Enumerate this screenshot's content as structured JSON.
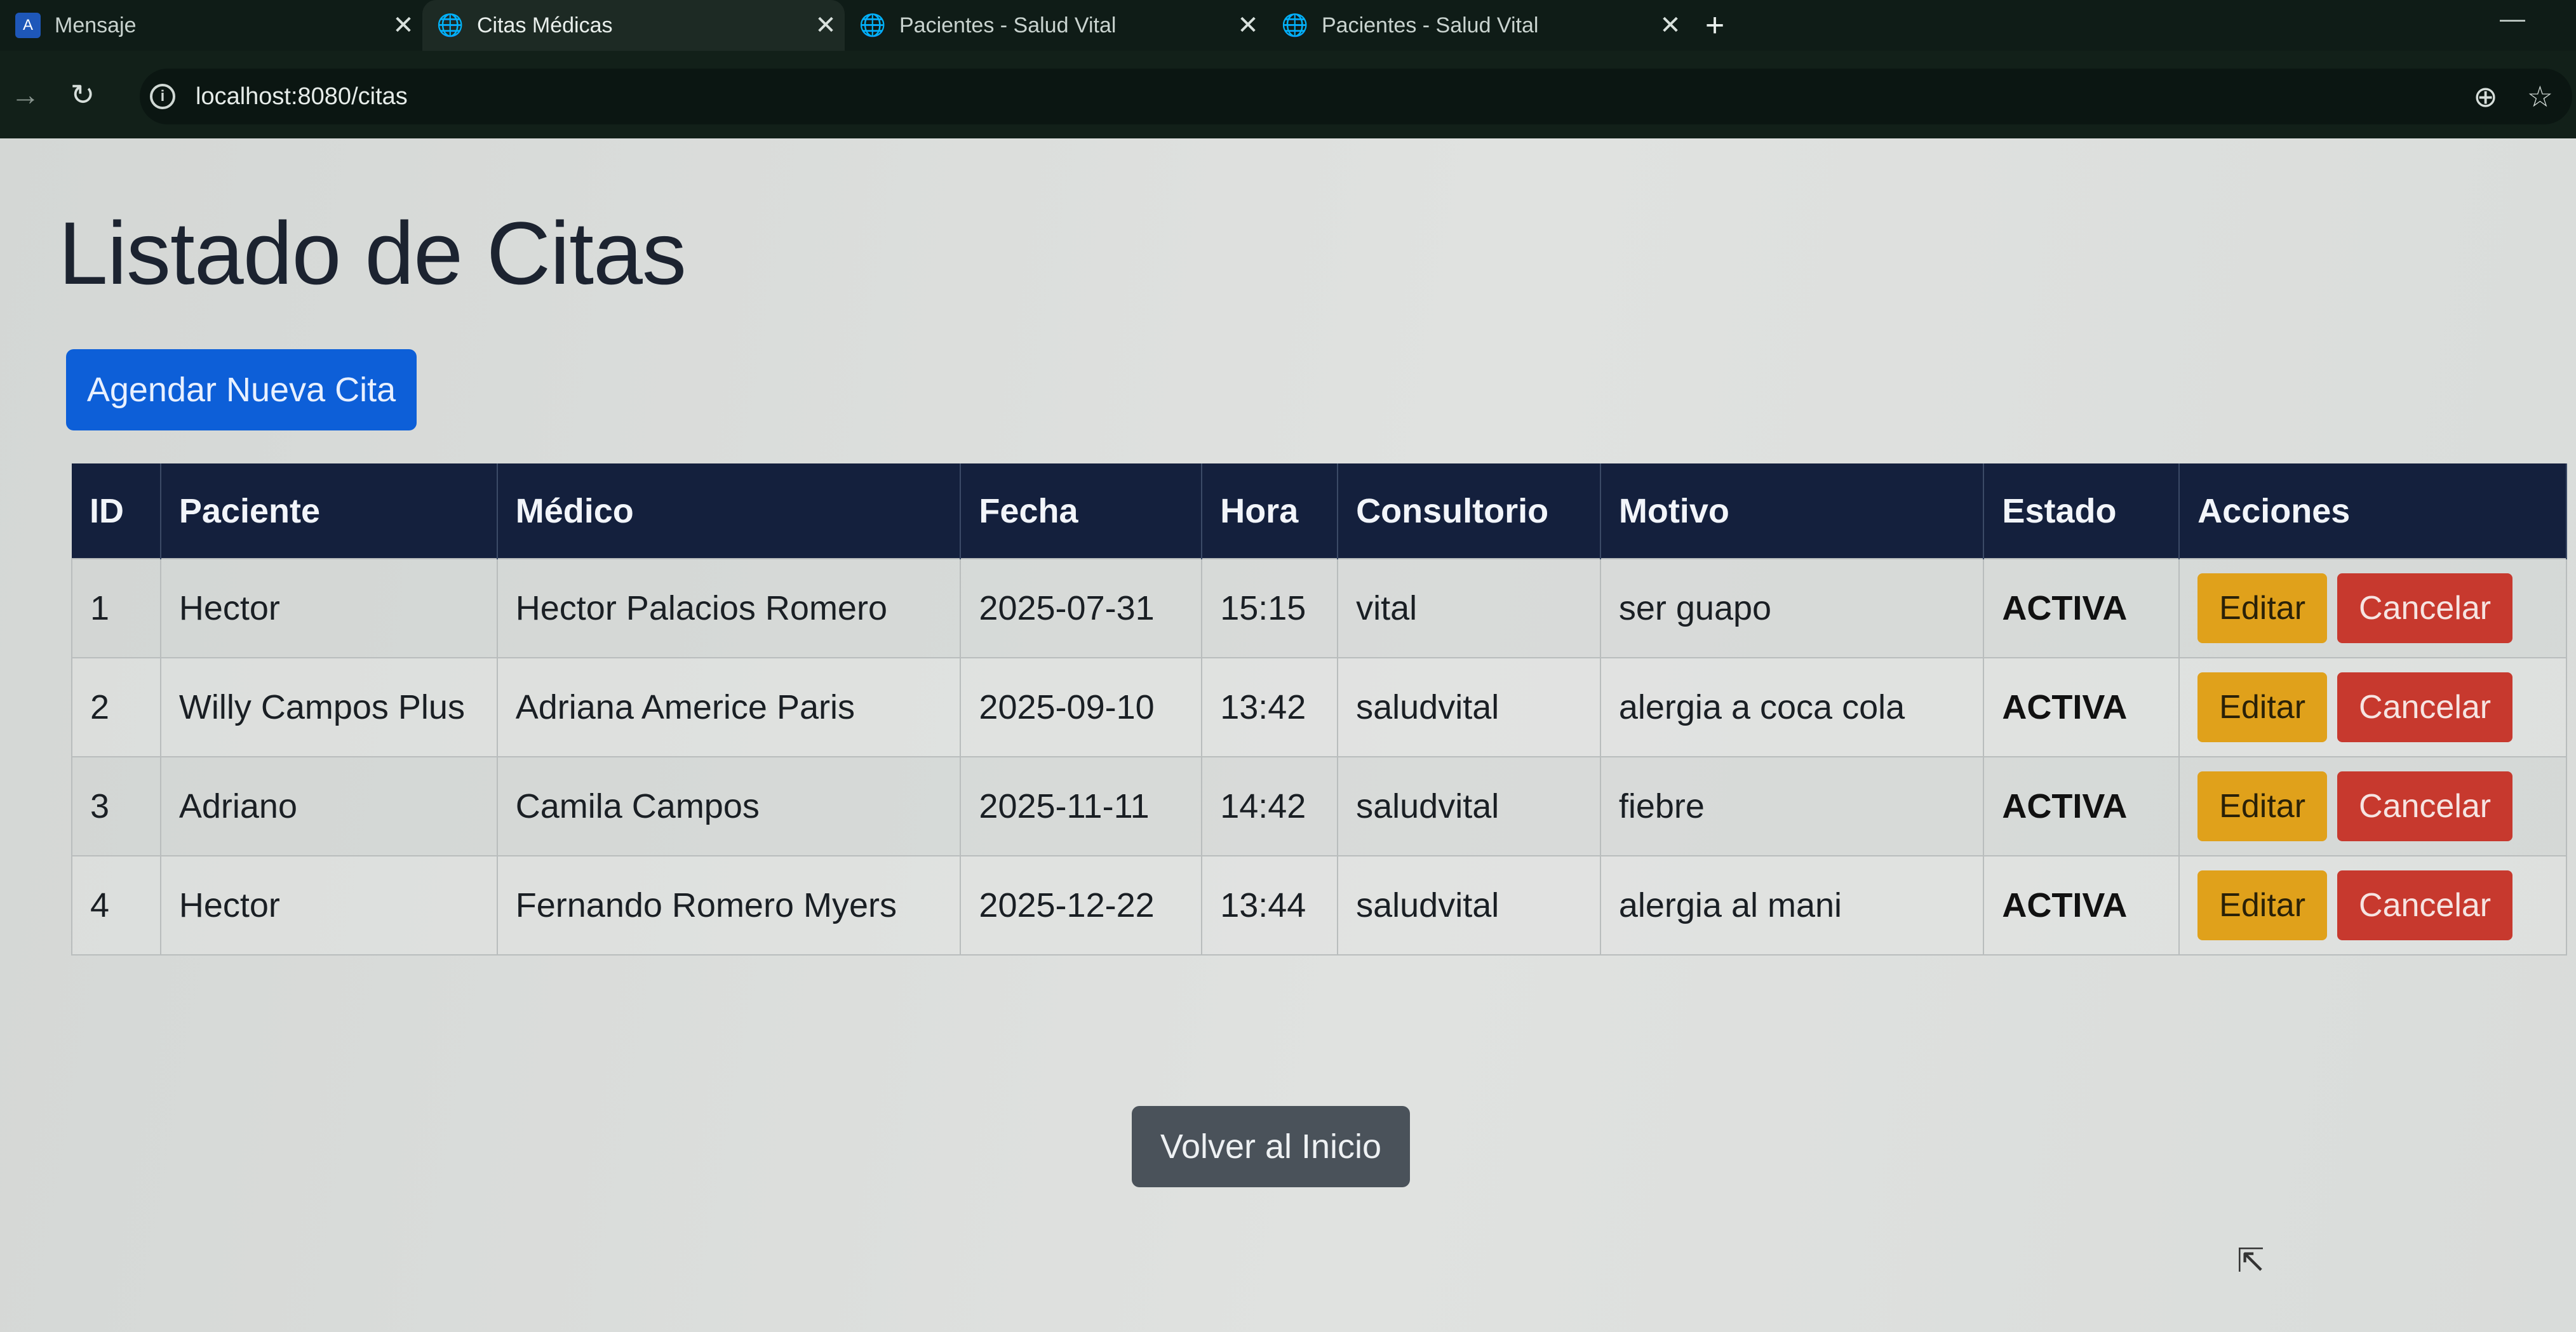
{
  "browser": {
    "tabs": [
      {
        "title": "Mensaje",
        "icon": "app-icon",
        "active": false
      },
      {
        "title": "Citas Médicas",
        "icon": "globe-icon",
        "active": true
      },
      {
        "title": "Pacientes - Salud Vital",
        "icon": "globe-icon",
        "active": false
      },
      {
        "title": "Pacientes - Salud Vital",
        "icon": "globe-icon",
        "active": false
      }
    ],
    "url": "localhost:8080/citas"
  },
  "page": {
    "title": "Listado de Citas",
    "new_button": "Agendar Nueva Cita",
    "home_button": "Volver al Inicio"
  },
  "table": {
    "headers": [
      "ID",
      "Paciente",
      "Médico",
      "Fecha",
      "Hora",
      "Consultorio",
      "Motivo",
      "Estado",
      "Acciones"
    ],
    "rows": [
      {
        "id": "1",
        "paciente": "Hector",
        "medico": "Hector Palacios Romero",
        "fecha": "2025-07-31",
        "hora": "15:15",
        "consultorio": "vital",
        "motivo": "ser guapo",
        "estado": "ACTIVA"
      },
      {
        "id": "2",
        "paciente": "Willy Campos Plus",
        "medico": "Adriana Americe Paris",
        "fecha": "2025-09-10",
        "hora": "13:42",
        "consultorio": "saludvital",
        "motivo": "alergia a coca cola",
        "estado": "ACTIVA"
      },
      {
        "id": "3",
        "paciente": "Adriano",
        "medico": "Camila Campos",
        "fecha": "2025-11-11",
        "hora": "14:42",
        "consultorio": "saludvital",
        "motivo": "fiebre",
        "estado": "ACTIVA"
      },
      {
        "id": "4",
        "paciente": "Hector",
        "medico": "Fernando Romero Myers",
        "fecha": "2025-12-22",
        "hora": "13:44",
        "consultorio": "saludvital",
        "motivo": "alergia al mani",
        "estado": "ACTIVA"
      }
    ],
    "edit_label": "Editar",
    "cancel_label": "Cancelar"
  },
  "colors": {
    "primary": "#0d5fd8",
    "header_bg": "#14203d",
    "warning": "#e0a11b",
    "danger": "#c7392e",
    "secondary": "#4a525a"
  }
}
